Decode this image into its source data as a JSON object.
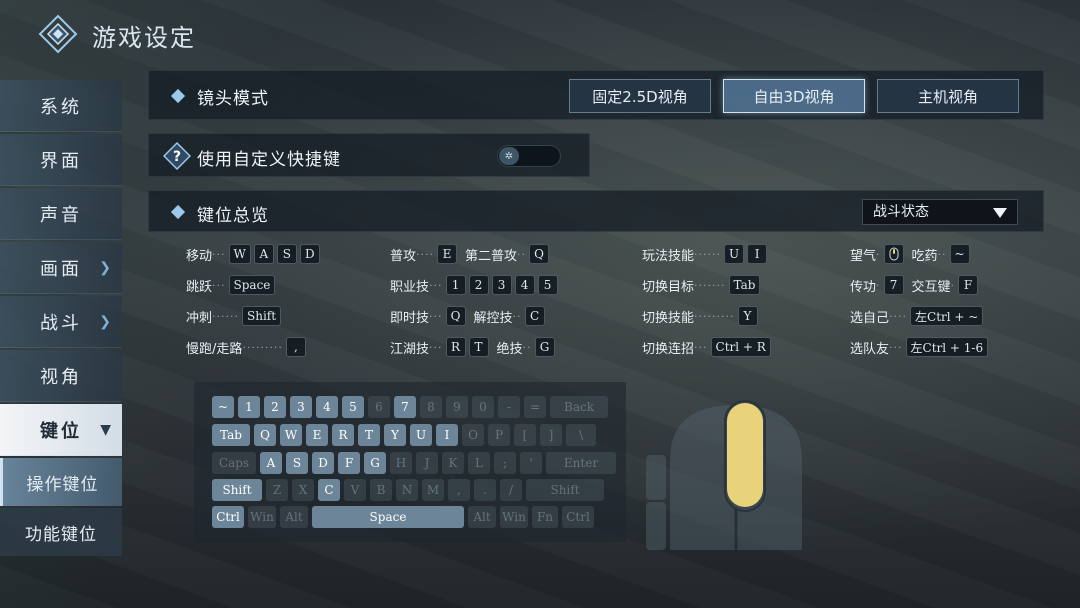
{
  "header": {
    "title": "游戏设定"
  },
  "sidebar": {
    "items": [
      {
        "label": "系统"
      },
      {
        "label": "界面"
      },
      {
        "label": "声音"
      },
      {
        "label": "画面"
      },
      {
        "label": "战斗"
      },
      {
        "label": "视角"
      },
      {
        "label": "键位"
      }
    ],
    "subitems": [
      {
        "label": "操作键位"
      },
      {
        "label": "功能键位"
      }
    ]
  },
  "camera": {
    "label": "镜头模式",
    "options": [
      "固定2.5D视角",
      "自由3D视角",
      "主机视角"
    ],
    "selected": "自由3D视角"
  },
  "custom_shortcut": {
    "label": "使用自定义快捷键",
    "enabled": false
  },
  "overview": {
    "label": "键位总览",
    "state_select": "战斗状态",
    "col1": [
      {
        "label": "移动",
        "keys": [
          "W",
          "A",
          "S",
          "D"
        ]
      },
      {
        "label": "跳跃",
        "keys": [
          "Space"
        ]
      },
      {
        "label": "冲刺",
        "keys": [
          "Shift"
        ]
      },
      {
        "label": "慢跑/走路",
        "keys": [
          ","
        ]
      }
    ],
    "col2": [
      {
        "label": "普攻",
        "keys": [
          "E"
        ],
        "label2": "第二普攻",
        "keys2": [
          "Q"
        ]
      },
      {
        "label": "职业技",
        "keys": [
          "1",
          "2",
          "3",
          "4",
          "5"
        ]
      },
      {
        "label": "即时技",
        "keys": [
          "Q"
        ],
        "label2": "解控技",
        "keys2": [
          "C"
        ]
      },
      {
        "label": "江湖技",
        "keys": [
          "R",
          "T"
        ],
        "label2": "绝技",
        "keys2": [
          "G"
        ]
      }
    ],
    "col3": [
      {
        "label": "玩法技能",
        "keys": [
          "U",
          "I"
        ]
      },
      {
        "label": "切换目标",
        "keys": [
          "Tab"
        ]
      },
      {
        "label": "切换技能",
        "keys": [
          "Y"
        ]
      },
      {
        "label": "切换连招",
        "keys": [
          "Ctrl + R"
        ]
      }
    ],
    "col4": [
      {
        "label": "望气",
        "keys": [
          ""
        ],
        "label2": "吃药",
        "keys2": [
          "~"
        ]
      },
      {
        "label": "传功",
        "keys": [
          "7"
        ],
        "label2": "交互键",
        "keys2": [
          "F"
        ]
      },
      {
        "label": "选自己",
        "keys": [
          "左Ctrl + ~"
        ]
      },
      {
        "label": "选队友",
        "keys": [
          "左Ctrl + 1-6"
        ]
      }
    ]
  },
  "keyboard": {
    "rows": [
      [
        [
          "~",
          1
        ],
        [
          "1",
          1
        ],
        [
          "2",
          1
        ],
        [
          "3",
          1
        ],
        [
          "4",
          1
        ],
        [
          "5",
          1
        ],
        [
          "6",
          0
        ],
        [
          "7",
          1
        ],
        [
          "8",
          0
        ],
        [
          "9",
          0
        ],
        [
          "0",
          0
        ],
        [
          "-",
          0
        ],
        [
          "=",
          0
        ],
        [
          "Back",
          0
        ]
      ],
      [
        [
          "Tab",
          1
        ],
        [
          "Q",
          1
        ],
        [
          "W",
          1
        ],
        [
          "E",
          1
        ],
        [
          "R",
          1
        ],
        [
          "T",
          1
        ],
        [
          "Y",
          1
        ],
        [
          "U",
          1
        ],
        [
          "I",
          1
        ],
        [
          "O",
          0
        ],
        [
          "P",
          0
        ],
        [
          "[",
          0
        ],
        [
          "]",
          0
        ],
        [
          "\\",
          0
        ]
      ],
      [
        [
          "Caps",
          0
        ],
        [
          "A",
          1
        ],
        [
          "S",
          1
        ],
        [
          "D",
          1
        ],
        [
          "F",
          1
        ],
        [
          "G",
          1
        ],
        [
          "H",
          0
        ],
        [
          "J",
          0
        ],
        [
          "K",
          0
        ],
        [
          "L",
          0
        ],
        [
          ";",
          0
        ],
        [
          "'",
          0
        ],
        [
          "Enter",
          0
        ]
      ],
      [
        [
          "Shift",
          1
        ],
        [
          "Z",
          0
        ],
        [
          "X",
          0
        ],
        [
          "C",
          1
        ],
        [
          "V",
          0
        ],
        [
          "B",
          0
        ],
        [
          "N",
          0
        ],
        [
          "M",
          0
        ],
        [
          ",",
          0
        ],
        [
          ".",
          0
        ],
        [
          "/",
          0
        ],
        [
          "Shift",
          0
        ]
      ],
      [
        [
          "Ctrl",
          1
        ],
        [
          "Win",
          0
        ],
        [
          "Alt",
          0
        ],
        [
          "Space",
          1
        ],
        [
          "Alt",
          0
        ],
        [
          "Win",
          0
        ],
        [
          "Fn",
          0
        ],
        [
          "Ctrl",
          0
        ]
      ]
    ]
  },
  "colors": {
    "accent": "#9cc8ea",
    "mouse_wheel": "#e8d27a"
  }
}
